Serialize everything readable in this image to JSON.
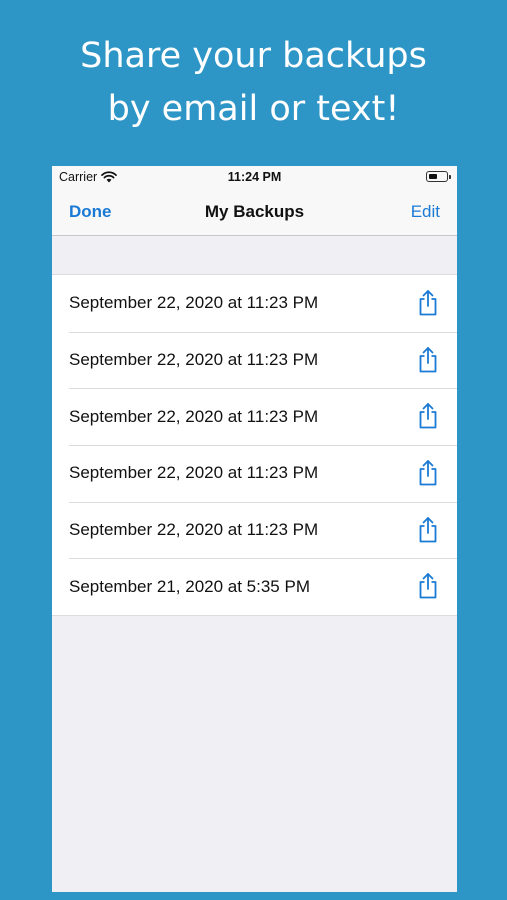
{
  "headline": {
    "line1": "Share your backups",
    "line2": "by email or text!"
  },
  "status_bar": {
    "carrier": "Carrier",
    "time": "11:24 PM",
    "icons": [
      "wifi-icon",
      "battery-icon"
    ]
  },
  "nav": {
    "left": "Done",
    "title": "My Backups",
    "right": "Edit"
  },
  "backups": [
    {
      "label": "September 22, 2020 at 11:23 PM",
      "icon": "share-icon"
    },
    {
      "label": "September 22, 2020 at 11:23 PM",
      "icon": "share-icon"
    },
    {
      "label": "September 22, 2020 at 11:23 PM",
      "icon": "share-icon"
    },
    {
      "label": "September 22, 2020 at 11:23 PM",
      "icon": "share-icon"
    },
    {
      "label": "September 22, 2020 at 11:23 PM",
      "icon": "share-icon"
    },
    {
      "label": "September 21, 2020 at 5:35 PM",
      "icon": "share-icon"
    }
  ],
  "colors": {
    "background": "#2e96c7",
    "accent": "#1a7ad4",
    "list_bg": "#efeff4"
  }
}
